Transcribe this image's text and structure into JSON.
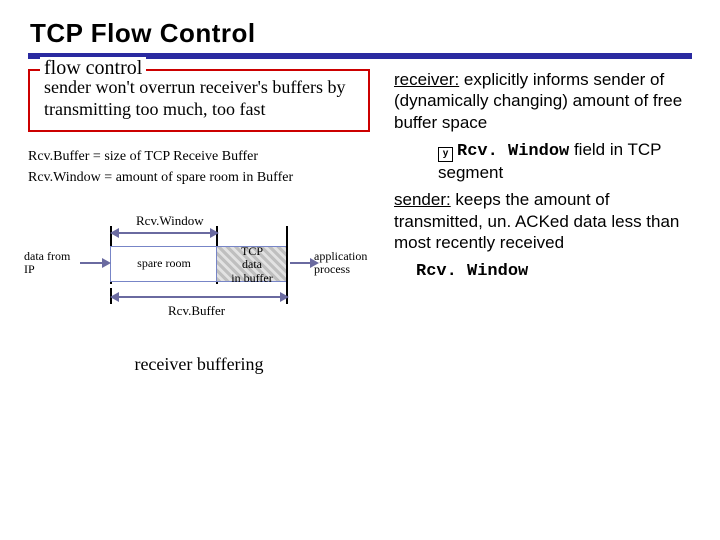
{
  "title": "TCP Flow Control",
  "left": {
    "legend": "flow control",
    "fieldbody": "sender won't overrun receiver's buffers by transmitting too much, too fast",
    "def1": "Rcv.Buffer = size of TCP Receive Buffer",
    "def2": "Rcv.Window = amount of spare room in Buffer",
    "caption": "receiver buffering"
  },
  "diagram": {
    "topLabel": "Rcv.Window",
    "leftLabel": "data from\nIP",
    "spare": "spare room",
    "data": "TCP\ndata\nin buffer",
    "rightLabel": "application\nprocess",
    "bottomLabel": "Rcv.Buffer"
  },
  "right": {
    "r1a": "receiver:",
    "r1b": " explicitly informs sender of (dynamically changing) amount of free buffer space",
    "r1c_code": "Rcv. Window",
    "r1c_tail": " field in TCP segment",
    "r2a": "sender:",
    "r2b": " keeps the amount of transmitted, un. ACKed data less than most recently received",
    "r2c_code": "Rcv. Window",
    "y": "y"
  }
}
